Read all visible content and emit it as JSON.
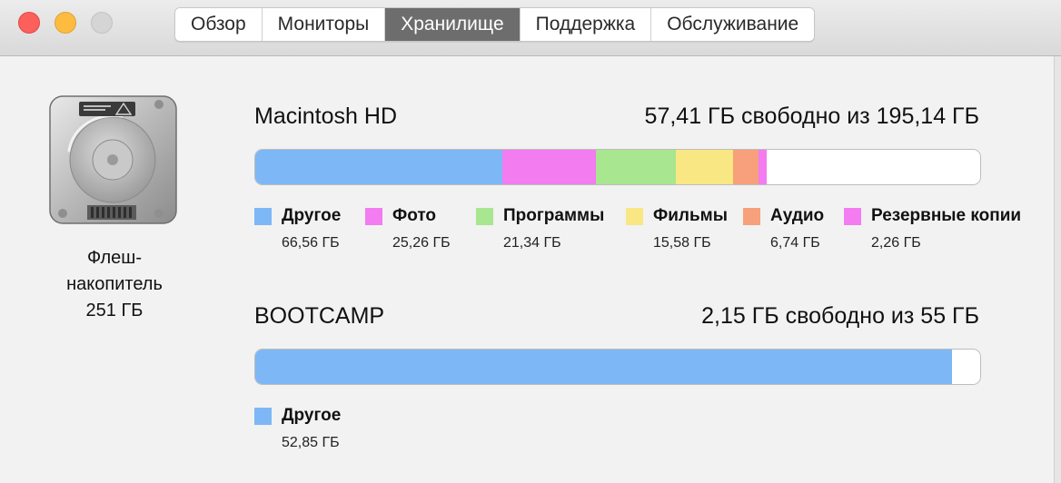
{
  "window": {
    "tabs": [
      {
        "label": "Обзор",
        "active": false
      },
      {
        "label": "Мониторы",
        "active": false
      },
      {
        "label": "Хранилище",
        "active": true
      },
      {
        "label": "Поддержка",
        "active": false
      },
      {
        "label": "Обслуживание",
        "active": false
      }
    ]
  },
  "drive": {
    "icon": "hard-drive-icon",
    "name": "Флеш-накопитель",
    "capacity": "251 ГБ"
  },
  "volumes": [
    {
      "name": "Macintosh HD",
      "free_text": "57,41 ГБ свободно из 195,14 ГБ",
      "free_gb": 57.41,
      "total_gb": 195.14,
      "categories": [
        {
          "label": "Другое",
          "size": "66,56 ГБ",
          "gb": 66.56,
          "color": "#7db7f5"
        },
        {
          "label": "Фото",
          "size": "25,26 ГБ",
          "gb": 25.26,
          "color": "#f27cf0"
        },
        {
          "label": "Программы",
          "size": "21,34 ГБ",
          "gb": 21.34,
          "color": "#a8e68f"
        },
        {
          "label": "Фильмы",
          "size": "15,58 ГБ",
          "gb": 15.58,
          "color": "#f8e783"
        },
        {
          "label": "Аудио",
          "size": "6,74 ГБ",
          "gb": 6.74,
          "color": "#f7a07b"
        },
        {
          "label": "Резервные копии",
          "size": "2,26 ГБ",
          "gb": 2.26,
          "color": "#f27cf0"
        }
      ]
    },
    {
      "name": "BOOTCAMP",
      "free_text": "2,15 ГБ свободно из 55 ГБ",
      "free_gb": 2.15,
      "total_gb": 55,
      "categories": [
        {
          "label": "Другое",
          "size": "52,85 ГБ",
          "gb": 52.85,
          "color": "#7db7f5"
        }
      ]
    }
  ]
}
